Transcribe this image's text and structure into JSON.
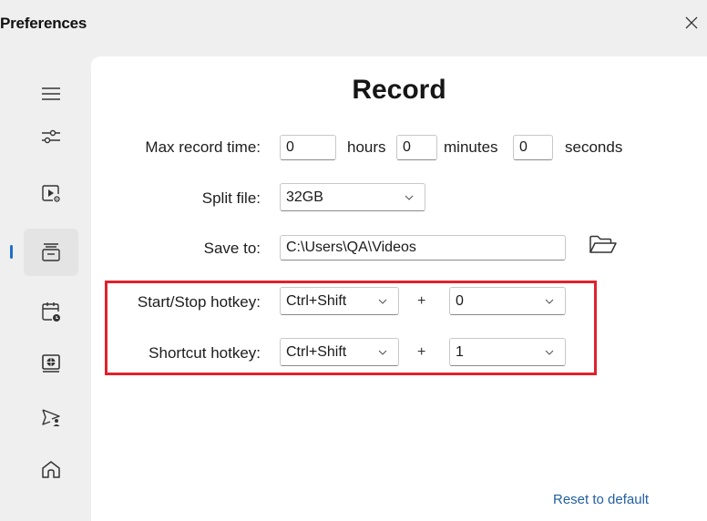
{
  "window": {
    "title": "Preferences"
  },
  "sidebar": {
    "items": [
      {
        "icon": "menu-icon",
        "active": false
      },
      {
        "icon": "sliders-icon",
        "active": false
      },
      {
        "icon": "video-settings-icon",
        "active": false
      },
      {
        "icon": "record-tray-icon",
        "active": true
      },
      {
        "icon": "calendar-clock-icon",
        "active": false
      },
      {
        "icon": "display-globe-icon",
        "active": false
      },
      {
        "icon": "send-user-icon",
        "active": false
      },
      {
        "icon": "home-icon",
        "active": false
      }
    ]
  },
  "page": {
    "title": "Record",
    "max_record_time": {
      "label": "Max record time:",
      "hours_value": "0",
      "hours_label": "hours",
      "minutes_value": "0",
      "minutes_label": "minutes",
      "seconds_value": "0",
      "seconds_label": "seconds"
    },
    "split_file": {
      "label": "Split file:",
      "value": "32GB"
    },
    "save_to": {
      "label": "Save to:",
      "value": "C:\\Users\\QA\\Videos"
    },
    "start_stop_hotkey": {
      "label": "Start/Stop hotkey:",
      "modifier": "Ctrl+Shift",
      "plus": "+",
      "key": "0"
    },
    "shortcut_hotkey": {
      "label": "Shortcut hotkey:",
      "modifier": "Ctrl+Shift",
      "plus": "+",
      "key": "1"
    },
    "reset_label": "Reset to default"
  },
  "colors": {
    "highlight": "#e0212b",
    "accent": "#1f6fc9",
    "link": "#23609f"
  }
}
